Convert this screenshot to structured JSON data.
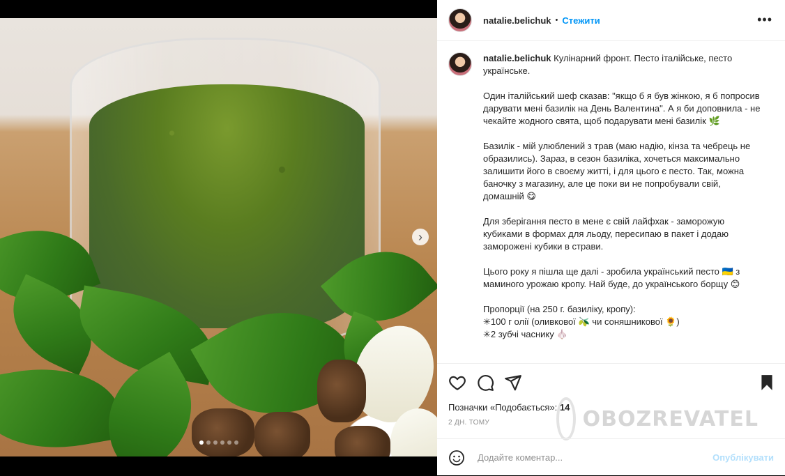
{
  "post": {
    "username": "natalie.belichuk",
    "separator": "•",
    "follow_label": "Стежити",
    "more_icon": "more-horizontal-icon"
  },
  "caption": {
    "username": "natalie.belichuk",
    "paragraphs": [
      "Кулінарний фронт. Песто італійське, песто українське.",
      "Один італійський шеф сказав: \"якщо б я був жінкою, я б попросив дарувати мені базилік на День Валентина\". А я би доповнила - не чекайте жодного свята, щоб подарувати мені базилік 🌿",
      "Базилік - мій улюблений з трав (маю надію, кінза та чебрець не образились). Зараз, в сезон базиліка, хочеться максимально залишити його в своєму житті, і для цього є песто. Так, можна баночку з магазину, але це поки ви не попробували свій, домашній 😋",
      "Для зберігання песто в мене є свій лайфхак - заморожую кубиками в формах для льоду, пересипаю в пакет і додаю заморожені кубики в страви.",
      "Цього року я пішла ще далі - зробила український песто 🇺🇦 з маминого урожаю кропу. Най буде, до українського борщу 😊",
      "Пропорції (на 250 г. базиліку, кропу):\n✳100 г олії (оливкової 🫒 чи соняшникової 🌻)\n✳2 зубчі часнику 🧄"
    ]
  },
  "stats": {
    "likes_label": "Позначки «Подобається»:",
    "likes_count": "14",
    "time_ago": "2 ДН. ТОМУ"
  },
  "watermark": {
    "text": "OBOZREVATEL"
  },
  "comment": {
    "placeholder": "Додайте коментар...",
    "publish_label": "Опублікувати"
  },
  "carousel": {
    "total_slides": 6,
    "current_slide": 1
  },
  "colors": {
    "accent": "#0095f6",
    "publish_disabled": "#b2dffc"
  }
}
